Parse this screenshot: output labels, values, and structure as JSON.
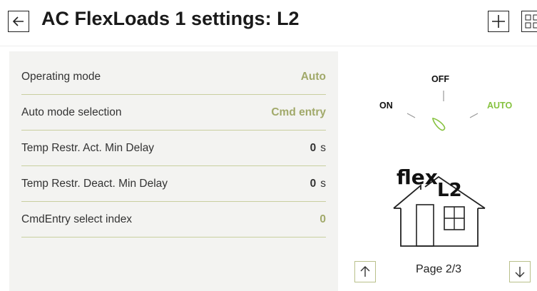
{
  "header": {
    "title": "AC FlexLoads 1 settings: L2",
    "back_icon": "arrow-left-icon",
    "add_icon": "plus-icon",
    "grid_icon": "grid-icon"
  },
  "settings": [
    {
      "label": "Operating mode",
      "value": "Auto",
      "unit": ""
    },
    {
      "label": "Auto mode selection",
      "value": "Cmd entry",
      "unit": ""
    },
    {
      "label": "Temp Restr. Act. Min Delay",
      "value": "0",
      "unit": "s"
    },
    {
      "label": "Temp Restr. Deact. Min Delay",
      "value": "0",
      "unit": "s"
    },
    {
      "label": "CmdEntry select index",
      "value": "0",
      "unit": ""
    }
  ],
  "switch": {
    "on": "ON",
    "off": "OFF",
    "auto": "AUTO",
    "active": "AUTO",
    "active_color": "#86c23f"
  },
  "house": {
    "brand": "flex",
    "sub": "L2"
  },
  "pagination": {
    "label": "Page 2/3",
    "up_icon": "arrow-up-icon",
    "down_icon": "arrow-down-icon"
  },
  "colors": {
    "accent": "#a1a96a",
    "panel_bg": "#f3f3f1",
    "divider": "#c9cf9f"
  }
}
